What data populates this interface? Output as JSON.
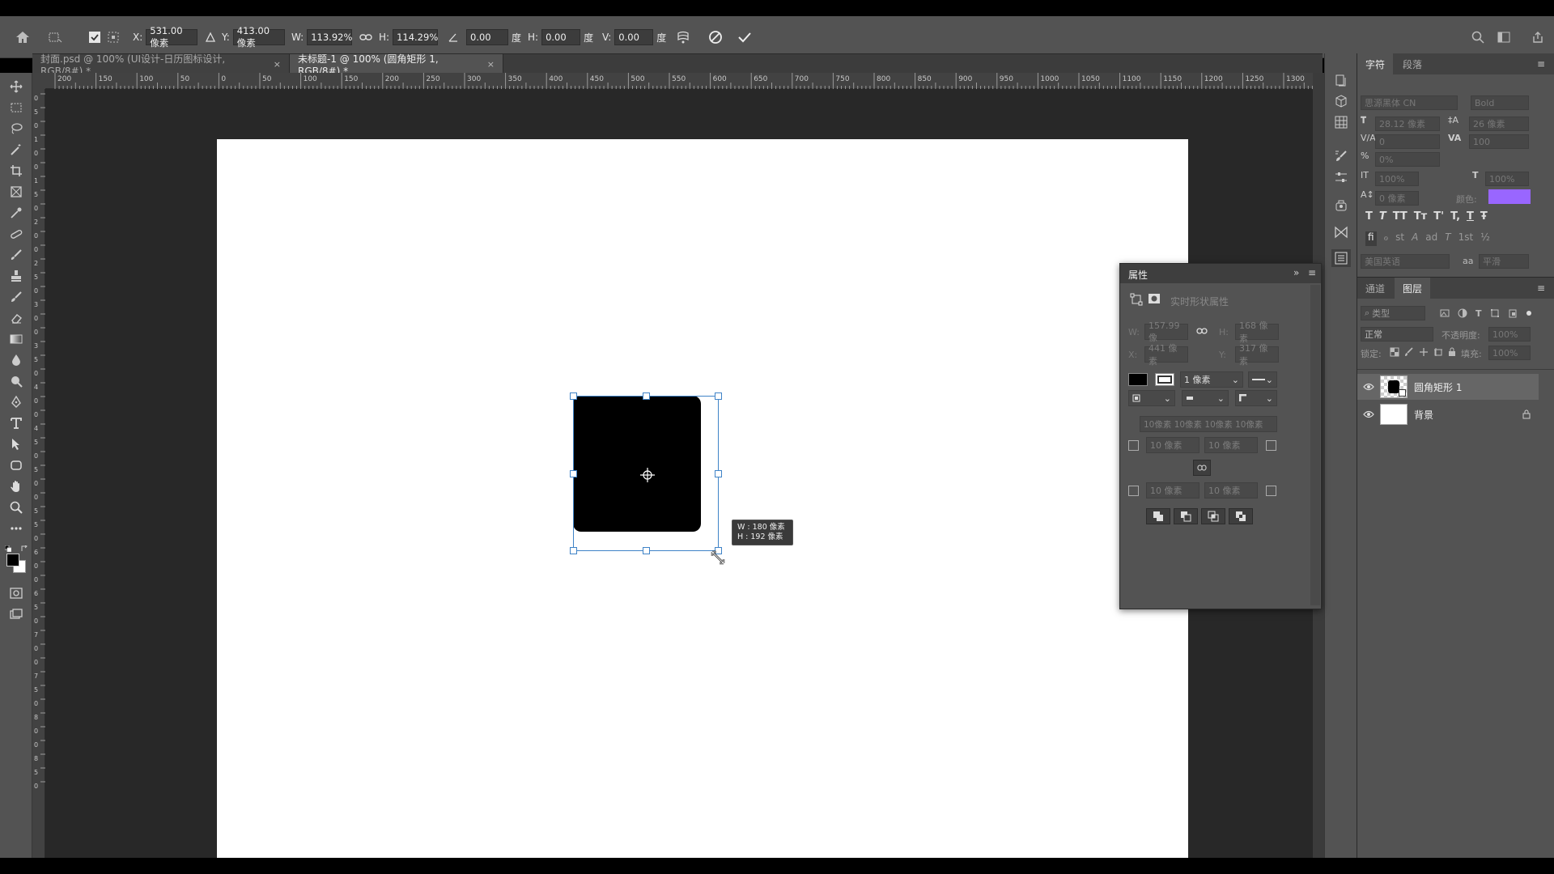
{
  "options_bar": {
    "x_label": "X:",
    "x_value": "531.00 像素",
    "y_label": "Y:",
    "y_value": "413.00 像素",
    "w_label": "W:",
    "w_value": "113.92%",
    "h_label": "H:",
    "h_value": "114.29%",
    "angle_value": "0.00",
    "deg_unit": "度",
    "hskew_label": "H:",
    "hskew_value": "0.00",
    "vskew_label": "V:",
    "vskew_value": "0.00"
  },
  "tabs": [
    {
      "label": "封面.psd @ 100% (UI设计-日历图标设计, RGB/8#) *",
      "close": "×"
    },
    {
      "label": "未标题-1 @ 100% (圆角矩形 1, RGB/8#) *",
      "close": "×"
    }
  ],
  "ruler_h_labels": [
    "200",
    "150",
    "100",
    "50",
    "0",
    "50",
    "100",
    "150",
    "200",
    "250",
    "300",
    "350",
    "400",
    "450",
    "500",
    "550",
    "600",
    "650",
    "700",
    "750",
    "800",
    "850",
    "900",
    "950",
    "1000",
    "1050",
    "1100",
    "1150",
    "1200",
    "1250",
    "1300"
  ],
  "ruler_v_labels": [
    "0",
    "5",
    "0",
    "1",
    "0",
    "0",
    "1",
    "5",
    "0",
    "2",
    "0",
    "0",
    "2",
    "5",
    "0",
    "3",
    "0",
    "0",
    "3",
    "5",
    "0",
    "4",
    "0",
    "0",
    "4",
    "5",
    "0",
    "5",
    "0",
    "0",
    "5",
    "5",
    "0",
    "6",
    "0",
    "0",
    "6",
    "5",
    "0",
    "7",
    "0",
    "0",
    "7",
    "5",
    "0",
    "8",
    "0",
    "0",
    "8",
    "5",
    "0"
  ],
  "transform_tooltip": {
    "line1": "W : 180 像素",
    "line2": "H : 192 像素"
  },
  "character_panel": {
    "tab_char": "字符",
    "tab_para": "段落",
    "font_family": "思源黑体 CN",
    "font_style": "Bold",
    "font_size": "28.12 像素",
    "leading": "26 像素",
    "kerning": "0",
    "tracking": "100",
    "tsume": "0%",
    "vscale": "100%",
    "hscale": "100%",
    "baseline": "0 像素",
    "color_label": "颜色:",
    "color_value": "#9966ff",
    "language": "美国英语",
    "aa_label": "aa",
    "antialias": "平滑",
    "style_buttons": [
      "T",
      "T",
      "TT",
      "Tт",
      "T'",
      "T,",
      "T",
      "Ŧ"
    ],
    "opentype_buttons": [
      "fi",
      "ℴ",
      "st",
      "A",
      "ad",
      "T",
      "1st",
      "½"
    ]
  },
  "properties_panel": {
    "title": "属性",
    "subtitle": "实时形状属性",
    "w_label": "W:",
    "w_value": "157.99 像",
    "h_label": "H:",
    "h_value": "168 像素",
    "x_label": "X:",
    "x_value": "441 像素",
    "y_label": "Y:",
    "y_value": "317 像素",
    "stroke_width": "1 像素",
    "corner_summary": "10像素 10像素 10像素 10像素",
    "corner_tl": "10 像素",
    "corner_tr": "10 像素",
    "corner_bl": "10 像素",
    "corner_br": "10 像素"
  },
  "layers_panel": {
    "tab_channels": "通道",
    "tab_layers": "图层",
    "filter_label": "类型",
    "blend_mode": "正常",
    "opacity_label": "不透明度:",
    "opacity_value": "100%",
    "lock_label": "锁定:",
    "fill_label": "填充:",
    "fill_value": "100%",
    "layers": [
      {
        "name": "圆角矩形 1",
        "selected": true
      },
      {
        "name": "背景",
        "selected": false
      }
    ]
  }
}
